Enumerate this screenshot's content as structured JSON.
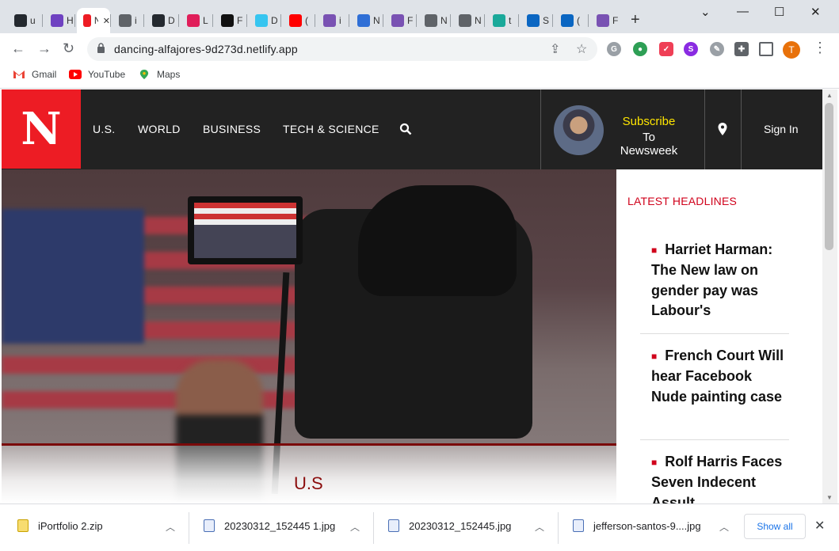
{
  "browser": {
    "tabs": [
      {
        "icon": "github-icon",
        "label": "u",
        "color": "#24292f"
      },
      {
        "icon": "shield-icon",
        "label": "H",
        "color": "#6f42c1"
      },
      {
        "icon": "newsweek-icon",
        "label": "N",
        "color": "#ed1c24",
        "active": true
      },
      {
        "icon": "globe-icon",
        "label": "i",
        "color": "#5f6368"
      },
      {
        "icon": "github-icon",
        "label": "D",
        "color": "#24292f"
      },
      {
        "icon": "slack-icon",
        "label": "L",
        "color": "#e01e5a"
      },
      {
        "icon": "grid-icon",
        "label": "F",
        "color": "#111111"
      },
      {
        "icon": "slack-icon",
        "label": "D",
        "color": "#36c5f0"
      },
      {
        "icon": "youtube-icon",
        "label": "(",
        "color": "#ff0000"
      },
      {
        "icon": "bootstrap-icon",
        "label": "i",
        "color": "#7952b3"
      },
      {
        "icon": "cloud-icon",
        "label": "N",
        "color": "#2f6fd6"
      },
      {
        "icon": "bootstrap-icon",
        "label": "F",
        "color": "#7952b3"
      },
      {
        "icon": "chrome-icon",
        "label": "N",
        "color": "#5f6368"
      },
      {
        "icon": "chrome-icon",
        "label": "N",
        "color": "#5f6368"
      },
      {
        "icon": "diamond-icon",
        "label": "t",
        "color": "#1aa99a"
      },
      {
        "icon": "linkedin-icon",
        "label": "S",
        "color": "#0a66c2"
      },
      {
        "icon": "linkedin-icon",
        "label": "(",
        "color": "#0a66c2"
      },
      {
        "icon": "bootstrap-icon",
        "label": "F",
        "color": "#7952b3"
      }
    ],
    "new_tab": "+",
    "window": {
      "minimize": "⌄",
      "min2": "—",
      "maximize": "☐",
      "close": "✕"
    },
    "url": "dancing-alfajores-9d273d.netlify.app",
    "profile_initial": "T",
    "bookmarks": [
      {
        "label": "Gmail",
        "icon": "gmail-icon"
      },
      {
        "label": "YouTube",
        "icon": "youtube-icon"
      },
      {
        "label": "Maps",
        "icon": "maps-icon"
      }
    ]
  },
  "site": {
    "logo": "N",
    "nav": [
      "U.S.",
      "WORLD",
      "BUSINESS",
      "TECH & SCIENCE"
    ],
    "subscribe_line1": "Subscribe",
    "subscribe_line2": "To Newsweek",
    "signin": "Sign In",
    "hero_category": "U.S",
    "latest_title": "LATEST HEADLINES",
    "headlines": [
      "Harriet Harman: The New law on gender pay was Labour's",
      "French Court Will hear Facebook Nude painting case",
      "Rolf Harris Faces Seven Indecent Assult"
    ],
    "accent": "#ed1c24"
  },
  "downloads": {
    "items": [
      {
        "name": "iPortfolio 2.zip",
        "type": "zip"
      },
      {
        "name": "20230312_152445 1.jpg",
        "type": "image"
      },
      {
        "name": "20230312_152445.jpg",
        "type": "image"
      },
      {
        "name": "jefferson-santos-9....jpg",
        "type": "image"
      }
    ],
    "show_all": "Show all"
  }
}
